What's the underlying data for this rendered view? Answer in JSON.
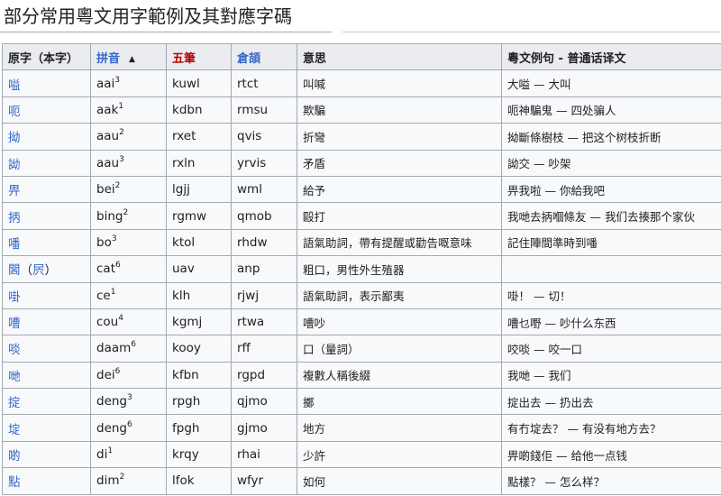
{
  "heading": "部分常用粵文用字範例及其對應字碼",
  "headers": {
    "original": "原字（本字）",
    "pinyin": "拼音",
    "wubi": "五筆",
    "cangjie": "倉頡",
    "meaning": "意思",
    "example": "粵文例句 - 普通话译文"
  },
  "rows": [
    {
      "char": "嗌",
      "paren_open": "",
      "alt": "",
      "paren_close": "",
      "py": "aai",
      "tone": "3",
      "wubi": "kuwl",
      "cangjie": "rtct",
      "meaning": "叫喊",
      "example": "大嗌 — 大叫"
    },
    {
      "char": "呃",
      "paren_open": "",
      "alt": "",
      "paren_close": "",
      "py": "aak",
      "tone": "1",
      "wubi": "kdbn",
      "cangjie": "rmsu",
      "meaning": "欺騙",
      "example": "呃神騙鬼 — 四处骗人"
    },
    {
      "char": "拗",
      "paren_open": "",
      "alt": "",
      "paren_close": "",
      "py": "aau",
      "tone": "2",
      "wubi": "rxet",
      "cangjie": "qvis",
      "meaning": "折彎",
      "example": "拗斷條樹枝 — 把这个树枝折断"
    },
    {
      "char": "詏",
      "paren_open": "",
      "alt": "",
      "paren_close": "",
      "py": "aau",
      "tone": "3",
      "wubi": "rxln",
      "cangjie": "yrvis",
      "meaning": "矛盾",
      "example": "詏交 — 吵架"
    },
    {
      "char": "畀",
      "paren_open": "",
      "alt": "",
      "paren_close": "",
      "py": "bei",
      "tone": "2",
      "wubi": "lgjj",
      "cangjie": "wml",
      "meaning": "給予",
      "example": "畀我啦 — 你給我吧"
    },
    {
      "char": "抦",
      "paren_open": "",
      "alt": "",
      "paren_close": "",
      "py": "bing",
      "tone": "2",
      "wubi": "rgmw",
      "cangjie": "qmob",
      "meaning": "毆打",
      "example": "我哋去抦嗰條友 — 我们去揍那个家伙"
    },
    {
      "char": "噃",
      "paren_open": "",
      "alt": "",
      "paren_close": "",
      "py": "bo",
      "tone": "3",
      "wubi": "ktol",
      "cangjie": "rhdw",
      "meaning": "語氣助詞，帶有提醒或勸告嘅意味",
      "example": "記住陣間準時到噃"
    },
    {
      "char": "閪",
      "paren_open": "（",
      "alt": "屄",
      "paren_close": "）",
      "py": "cat",
      "tone": "6",
      "wubi": "uav",
      "cangjie": "anp",
      "meaning": "粗口，男性外生殖器",
      "example": ""
    },
    {
      "char": "啩",
      "paren_open": "",
      "alt": "",
      "paren_close": "",
      "py": "ce",
      "tone": "1",
      "wubi": "klh",
      "cangjie": "rjwj",
      "meaning": "語氣助詞，表示鄙夷",
      "example": "啩！ — 切！"
    },
    {
      "char": "嘈",
      "paren_open": "",
      "alt": "",
      "paren_close": "",
      "py": "cou",
      "tone": "4",
      "wubi": "kgmj",
      "cangjie": "rtwa",
      "meaning": "嘈吵",
      "example": "嘈乜嘢 — 吵什么东西"
    },
    {
      "char": "啖",
      "paren_open": "",
      "alt": "",
      "paren_close": "",
      "py": "daam",
      "tone": "6",
      "wubi": "kooy",
      "cangjie": "rff",
      "meaning": "口（量詞）",
      "example": "咬啖 — 咬一口"
    },
    {
      "char": "哋",
      "paren_open": "",
      "alt": "",
      "paren_close": "",
      "py": "dei",
      "tone": "6",
      "wubi": "kfbn",
      "cangjie": "rgpd",
      "meaning": "複數人稱後綴",
      "example": "我哋 — 我们"
    },
    {
      "char": "掟",
      "paren_open": "",
      "alt": "",
      "paren_close": "",
      "py": "deng",
      "tone": "3",
      "wubi": "rpgh",
      "cangjie": "qjmo",
      "meaning": "擲",
      "example": "掟出去 — 扔出去"
    },
    {
      "char": "埞",
      "paren_open": "",
      "alt": "",
      "paren_close": "",
      "py": "deng",
      "tone": "6",
      "wubi": "fpgh",
      "cangjie": "gjmo",
      "meaning": "地方",
      "example": "有冇埞去？ — 有没有地方去？"
    },
    {
      "char": "啲",
      "paren_open": "",
      "alt": "",
      "paren_close": "",
      "py": "di",
      "tone": "1",
      "wubi": "krqy",
      "cangjie": "rhai",
      "meaning": "少許",
      "example": "畀啲錢佢 — 给他一点钱"
    },
    {
      "char": "點",
      "paren_open": "",
      "alt": "",
      "paren_close": "",
      "py": "dim",
      "tone": "2",
      "wubi": "lfok",
      "cangjie": "wfyr",
      "meaning": "如何",
      "example": "點樣？ — 怎么样？"
    }
  ]
}
